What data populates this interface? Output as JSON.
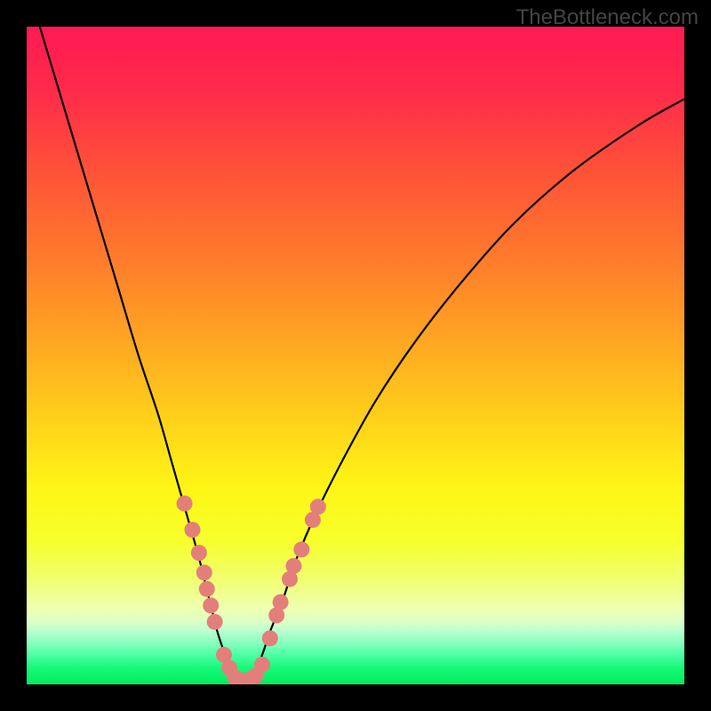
{
  "watermark": "TheBottleneck.com",
  "chart_data": {
    "type": "line",
    "title": "",
    "xlabel": "",
    "ylabel": "",
    "xlim": [
      0,
      100
    ],
    "ylim": [
      0,
      100
    ],
    "series": [
      {
        "name": "bottleneck-curve",
        "x": [
          2,
          5,
          8,
          11,
          14,
          17,
          20,
          22,
          24,
          26,
          27,
          28,
          29,
          30,
          31,
          32,
          33,
          34,
          35,
          36,
          37,
          39,
          41,
          44,
          48,
          53,
          59,
          66,
          74,
          83,
          93,
          100
        ],
        "y": [
          100,
          90,
          80,
          70,
          60,
          50,
          41,
          34,
          27,
          20,
          16,
          12,
          8,
          5,
          2.5,
          1,
          0.5,
          1,
          2.5,
          5,
          8,
          13,
          19,
          26,
          34,
          43,
          52,
          61,
          70,
          78,
          85,
          89
        ]
      }
    ],
    "markers": [
      {
        "x": 24.0,
        "y": 27.5
      },
      {
        "x": 25.2,
        "y": 23.5
      },
      {
        "x": 26.2,
        "y": 20.0
      },
      {
        "x": 27.0,
        "y": 17.0
      },
      {
        "x": 27.4,
        "y": 14.5
      },
      {
        "x": 28.0,
        "y": 12.0
      },
      {
        "x": 28.6,
        "y": 9.5
      },
      {
        "x": 30.0,
        "y": 4.5
      },
      {
        "x": 30.8,
        "y": 2.5
      },
      {
        "x": 31.7,
        "y": 1.0
      },
      {
        "x": 32.7,
        "y": 0.6
      },
      {
        "x": 33.8,
        "y": 0.7
      },
      {
        "x": 34.8,
        "y": 1.3
      },
      {
        "x": 35.8,
        "y": 3.0
      },
      {
        "x": 37.0,
        "y": 7.0
      },
      {
        "x": 38.0,
        "y": 10.5
      },
      {
        "x": 38.6,
        "y": 12.5
      },
      {
        "x": 40.0,
        "y": 16.0
      },
      {
        "x": 40.6,
        "y": 18.0
      },
      {
        "x": 41.8,
        "y": 20.5
      },
      {
        "x": 43.5,
        "y": 25.0
      },
      {
        "x": 44.3,
        "y": 27.0
      }
    ],
    "gradient_stops": [
      {
        "offset": 0.0,
        "color": "#ff1a52"
      },
      {
        "offset": 0.1,
        "color": "#ff2b4a"
      },
      {
        "offset": 0.22,
        "color": "#ff5238"
      },
      {
        "offset": 0.35,
        "color": "#ff7a2c"
      },
      {
        "offset": 0.48,
        "color": "#ffa722"
      },
      {
        "offset": 0.6,
        "color": "#ffd21a"
      },
      {
        "offset": 0.7,
        "color": "#fff516"
      },
      {
        "offset": 0.78,
        "color": "#f7ff2a"
      },
      {
        "offset": 0.84,
        "color": "#f0ff70"
      },
      {
        "offset": 0.885,
        "color": "#eeffb0"
      },
      {
        "offset": 0.905,
        "color": "#dcffc8"
      },
      {
        "offset": 0.92,
        "color": "#b7ffcf"
      },
      {
        "offset": 0.935,
        "color": "#8effc0"
      },
      {
        "offset": 0.955,
        "color": "#4effa5"
      },
      {
        "offset": 0.975,
        "color": "#18f878"
      },
      {
        "offset": 1.0,
        "color": "#00ef5c"
      }
    ],
    "marker_color": "#e37f7a",
    "curve_color": "#000000"
  }
}
